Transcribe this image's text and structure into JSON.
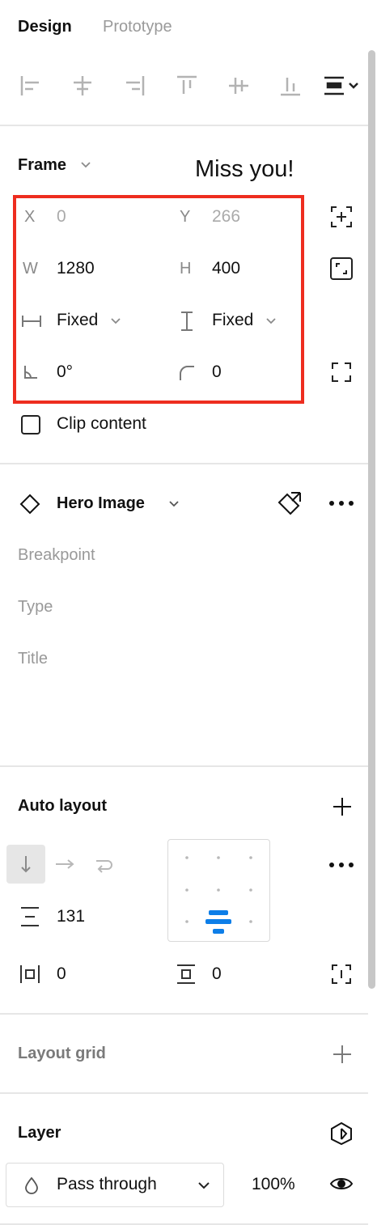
{
  "tabs": {
    "design": "Design",
    "prototype": "Prototype"
  },
  "frame": {
    "title": "Frame",
    "overlay_text": "Miss you!",
    "x_label": "X",
    "x_value": "0",
    "y_label": "Y",
    "y_value": "266",
    "w_label": "W",
    "w_value": "1280",
    "h_label": "H",
    "h_value": "400",
    "w_sizing": "Fixed",
    "h_sizing": "Fixed",
    "rotation": "0°",
    "radius": "0",
    "clip_content": "Clip content",
    "clip_checked": false
  },
  "component": {
    "name": "Hero Image",
    "props": [
      "Breakpoint",
      "Type",
      "Title"
    ]
  },
  "auto_layout": {
    "title": "Auto layout",
    "spacing": "131",
    "padding_h": "0",
    "padding_v": "0",
    "alignment": "bottom-center"
  },
  "layout_grid": {
    "title": "Layout grid"
  },
  "layer": {
    "title": "Layer",
    "blend_mode": "Pass through",
    "opacity": "100%"
  },
  "colors": {
    "accent": "#0d7ee8",
    "highlight_border": "#ee2d1f"
  }
}
